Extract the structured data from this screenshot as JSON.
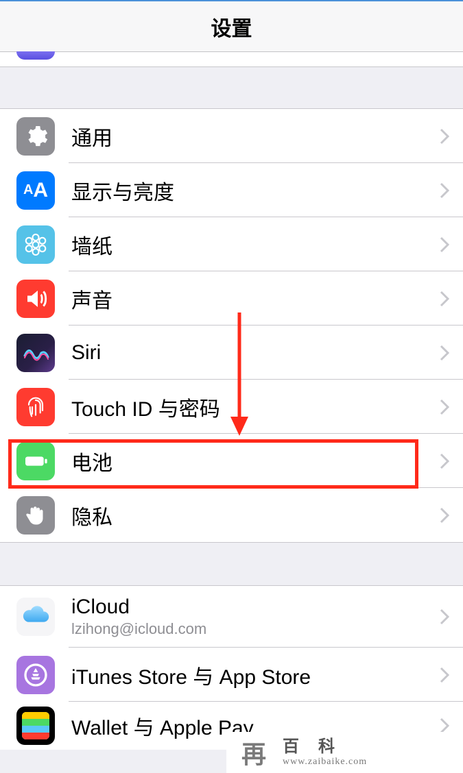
{
  "header": {
    "title": "设置"
  },
  "group1": {
    "items": [
      {
        "label": "通用"
      },
      {
        "label": "显示与亮度"
      },
      {
        "label": "墙纸"
      },
      {
        "label": "声音"
      },
      {
        "label": "Siri"
      },
      {
        "label": "Touch ID 与密码"
      },
      {
        "label": "电池"
      },
      {
        "label": "隐私"
      }
    ]
  },
  "group2": {
    "items": [
      {
        "label": "iCloud",
        "sub": "lzihong@icloud.com"
      },
      {
        "label": "iTunes Store 与 App Store"
      },
      {
        "label": "Wallet 与 Apple Pay"
      }
    ]
  },
  "watermark": {
    "glyph": "再",
    "title": "百科",
    "url": "www.zaibaike.com"
  }
}
